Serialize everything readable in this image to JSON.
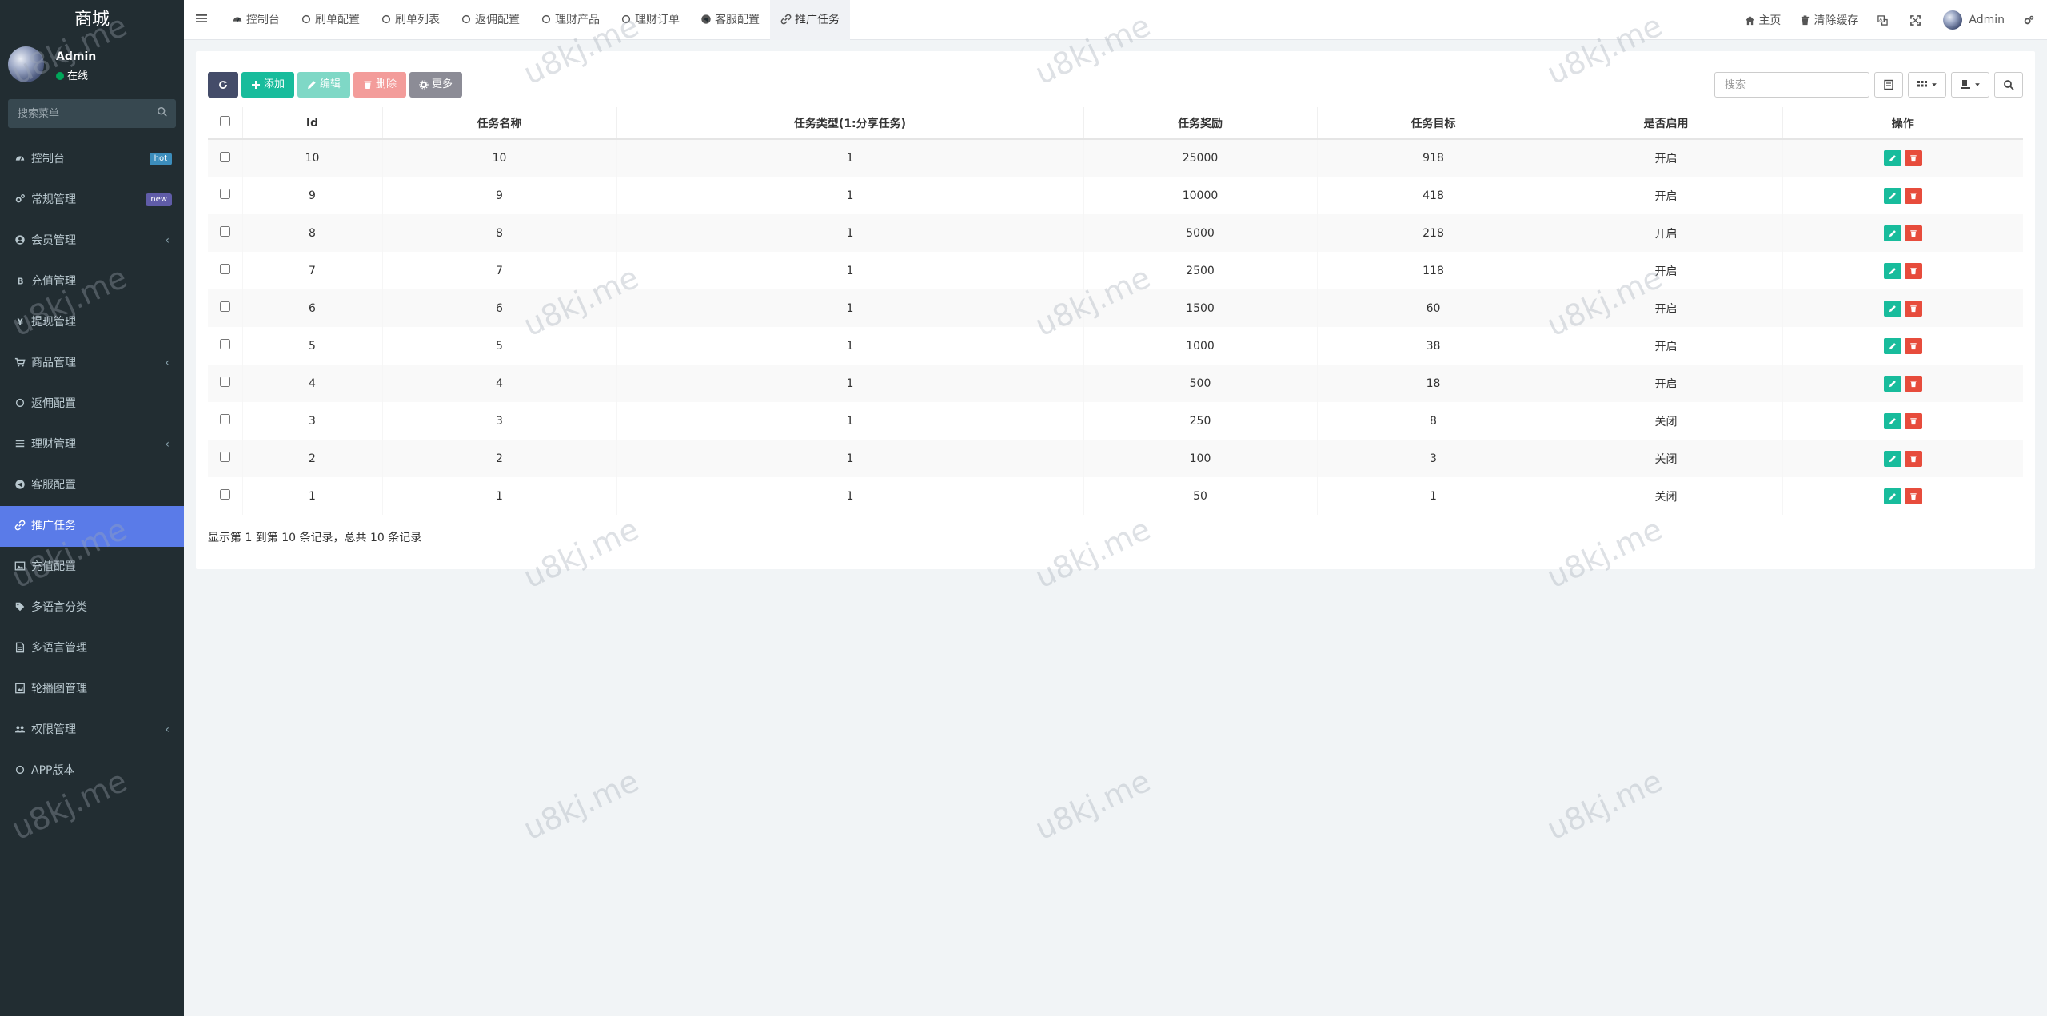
{
  "sidebar": {
    "brand": "商城",
    "user": {
      "name": "Admin",
      "status": "在线"
    },
    "search_placeholder": "搜索菜单",
    "items": [
      {
        "label": "控制台",
        "icon": "dashboard-icon",
        "badge": "hot"
      },
      {
        "label": "常规管理",
        "icon": "cogs-icon",
        "badge": "new"
      },
      {
        "label": "会员管理",
        "icon": "user-circle-icon",
        "chevron": "‹"
      },
      {
        "label": "充值管理",
        "icon": "bitcoin-icon"
      },
      {
        "label": "提现管理",
        "icon": "yen-icon"
      },
      {
        "label": "商品管理",
        "icon": "cart-icon",
        "chevron": "‹"
      },
      {
        "label": "返佣配置",
        "icon": "circle-icon"
      },
      {
        "label": "理财管理",
        "icon": "list-icon",
        "chevron": "‹"
      },
      {
        "label": "客服配置",
        "icon": "telegram-icon"
      },
      {
        "label": "推广任务",
        "icon": "link-icon",
        "active": true
      },
      {
        "label": "充值配置",
        "icon": "image-icon"
      },
      {
        "label": "多语言分类",
        "icon": "tag-icon"
      },
      {
        "label": "多语言管理",
        "icon": "file-icon"
      },
      {
        "label": "轮播图管理",
        "icon": "picture-icon"
      },
      {
        "label": "权限管理",
        "icon": "group-icon",
        "chevron": "‹"
      },
      {
        "label": "APP版本",
        "icon": "circle-icon"
      }
    ]
  },
  "topbar": {
    "tabs": [
      {
        "label": "控制台",
        "icon": "dashboard-icon"
      },
      {
        "label": "刷单配置",
        "icon": "circle-icon"
      },
      {
        "label": "刷单列表",
        "icon": "circle-icon"
      },
      {
        "label": "返佣配置",
        "icon": "circle-icon"
      },
      {
        "label": "理财产品",
        "icon": "circle-icon"
      },
      {
        "label": "理财订单",
        "icon": "circle-icon"
      },
      {
        "label": "客服配置",
        "icon": "telegram-icon"
      },
      {
        "label": "推广任务",
        "icon": "link-icon",
        "active": true
      }
    ],
    "home_label": "主页",
    "clear_cache_label": "清除缓存",
    "admin_label": "Admin"
  },
  "toolbar": {
    "add_label": "添加",
    "edit_label": "编辑",
    "delete_label": "删除",
    "more_label": "更多",
    "search_placeholder": "搜索"
  },
  "table": {
    "columns": [
      "Id",
      "任务名称",
      "任务类型(1:分享任务)",
      "任务奖励",
      "任务目标",
      "是否启用",
      "操作"
    ],
    "rows": [
      [
        "10",
        "10",
        "1",
        "25000",
        "918",
        "开启"
      ],
      [
        "9",
        "9",
        "1",
        "10000",
        "418",
        "开启"
      ],
      [
        "8",
        "8",
        "1",
        "5000",
        "218",
        "开启"
      ],
      [
        "7",
        "7",
        "1",
        "2500",
        "118",
        "开启"
      ],
      [
        "6",
        "6",
        "1",
        "1500",
        "60",
        "开启"
      ],
      [
        "5",
        "5",
        "1",
        "1000",
        "38",
        "开启"
      ],
      [
        "4",
        "4",
        "1",
        "500",
        "18",
        "开启"
      ],
      [
        "3",
        "3",
        "1",
        "250",
        "8",
        "关闭"
      ],
      [
        "2",
        "2",
        "1",
        "100",
        "3",
        "关闭"
      ],
      [
        "1",
        "1",
        "1",
        "50",
        "1",
        "关闭"
      ]
    ]
  },
  "pagination_info": "显示第 1 到第 10 条记录，总共 10 条记录",
  "watermark": "u8kj.me",
  "colors": {
    "sidebar_bg": "#222d32",
    "active_menu": "#5a7be8",
    "success": "#18bc9c",
    "danger": "#e74c3c"
  }
}
